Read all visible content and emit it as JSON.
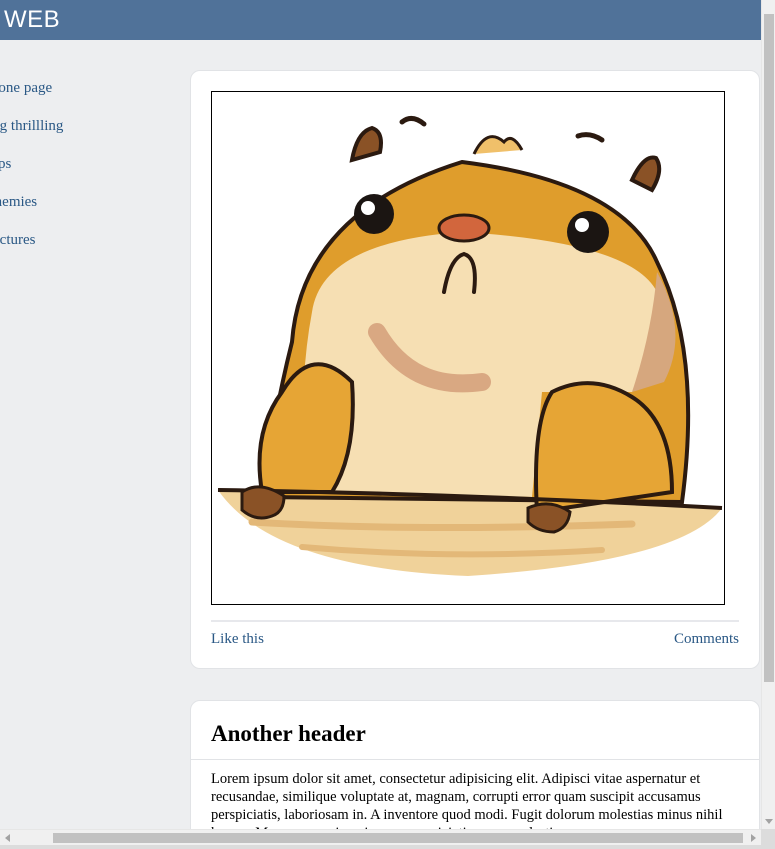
{
  "header": {
    "brand": "WEB"
  },
  "sidebar": {
    "items": [
      {
        "label": "e one page"
      },
      {
        "label": "ing thrillling"
      },
      {
        "label": "sips"
      },
      {
        "label": "enemies"
      },
      {
        "label": "pictures"
      }
    ]
  },
  "post": {
    "image_subject": "hamster-illustration",
    "like_label": "Like this",
    "comments_label": "Comments"
  },
  "article": {
    "title": "Another header",
    "body": "Lorem ipsum dolor sit amet, consectetur adipisicing elit. Adipisci vitae aspernatur et recusandae, similique voluptate at, magnam, corrupti error quam suscipit accusamus perspiciatis, laboriosam in. A inventore quod modi. Fugit dolorum molestias minus nihil harum. Magnam maxime, ipsam, perspiciatis, quos molestias"
  },
  "colors": {
    "topbar": "#507299",
    "link": "#2a5885",
    "background": "#edeef0"
  }
}
